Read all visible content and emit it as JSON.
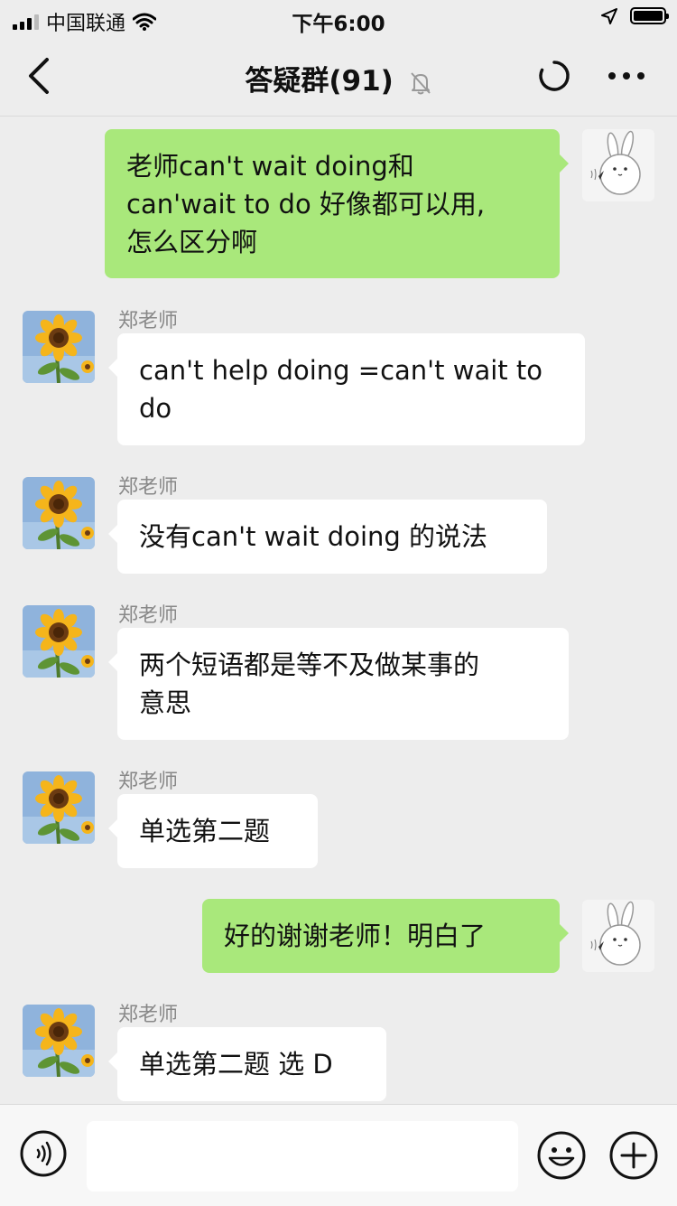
{
  "status_bar": {
    "carrier": "中国联通",
    "time": "下午6:00"
  },
  "header": {
    "title": "答疑群(91)"
  },
  "messages": [
    {
      "side": "out",
      "text": "老师can't wait doing和\ncan'wait to do 好像都可以用,\n怎么区分啊"
    },
    {
      "side": "in",
      "sender": "郑老师",
      "text": "can't help doing =can't wait to\ndo"
    },
    {
      "side": "in",
      "sender": "郑老师",
      "text": "没有can't wait doing 的说法"
    },
    {
      "side": "in",
      "sender": "郑老师",
      "text": "两个短语都是等不及做某事的\n意思"
    },
    {
      "side": "in",
      "sender": "郑老师",
      "text": "单选第二题"
    },
    {
      "side": "out",
      "text": "好的谢谢老师！明白了"
    },
    {
      "side": "in",
      "sender": "郑老师",
      "text": "单选第二题 选 D"
    }
  ],
  "input": {
    "value": ""
  },
  "colors": {
    "outgoing_bubble": "#A9E87B",
    "incoming_bubble": "#FFFFFF",
    "background": "#EDEDED"
  },
  "icons": [
    "back-chevron-icon",
    "mute-bell-icon",
    "refresh-icon",
    "more-icon",
    "voice-icon",
    "emoji-icon",
    "plus-icon"
  ]
}
